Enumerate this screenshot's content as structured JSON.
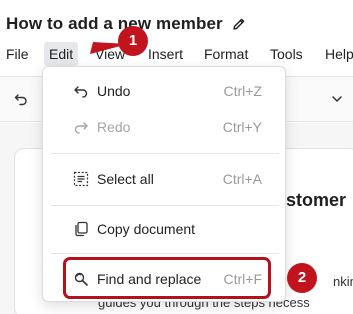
{
  "document": {
    "title": "How to add a new member",
    "heading_fragment": "stomer",
    "text_fragment_1": "nking",
    "text_fragment_2": "guides you through the steps necess"
  },
  "menubar": {
    "items": [
      {
        "label": "File"
      },
      {
        "label": "Edit"
      },
      {
        "label": "View"
      },
      {
        "label": "Insert"
      },
      {
        "label": "Format"
      },
      {
        "label": "Tools"
      },
      {
        "label": "Help"
      }
    ],
    "active": "Edit"
  },
  "edit_menu": {
    "items": [
      {
        "label": "Undo",
        "shortcut": "Ctrl+Z",
        "icon": "undo-icon",
        "enabled": true
      },
      {
        "label": "Redo",
        "shortcut": "Ctrl+Y",
        "icon": "redo-icon",
        "enabled": false
      },
      {
        "label": "Select all",
        "shortcut": "Ctrl+A",
        "icon": "select-all-icon",
        "enabled": true
      },
      {
        "label": "Copy document",
        "shortcut": "",
        "icon": "copy-document-icon",
        "enabled": true
      },
      {
        "label": "Find and replace",
        "shortcut": "Ctrl+F",
        "icon": "find-replace-icon",
        "enabled": true
      }
    ]
  },
  "annotations": {
    "callout_1": "1",
    "callout_2": "2",
    "accent_color": "#c2141f"
  }
}
